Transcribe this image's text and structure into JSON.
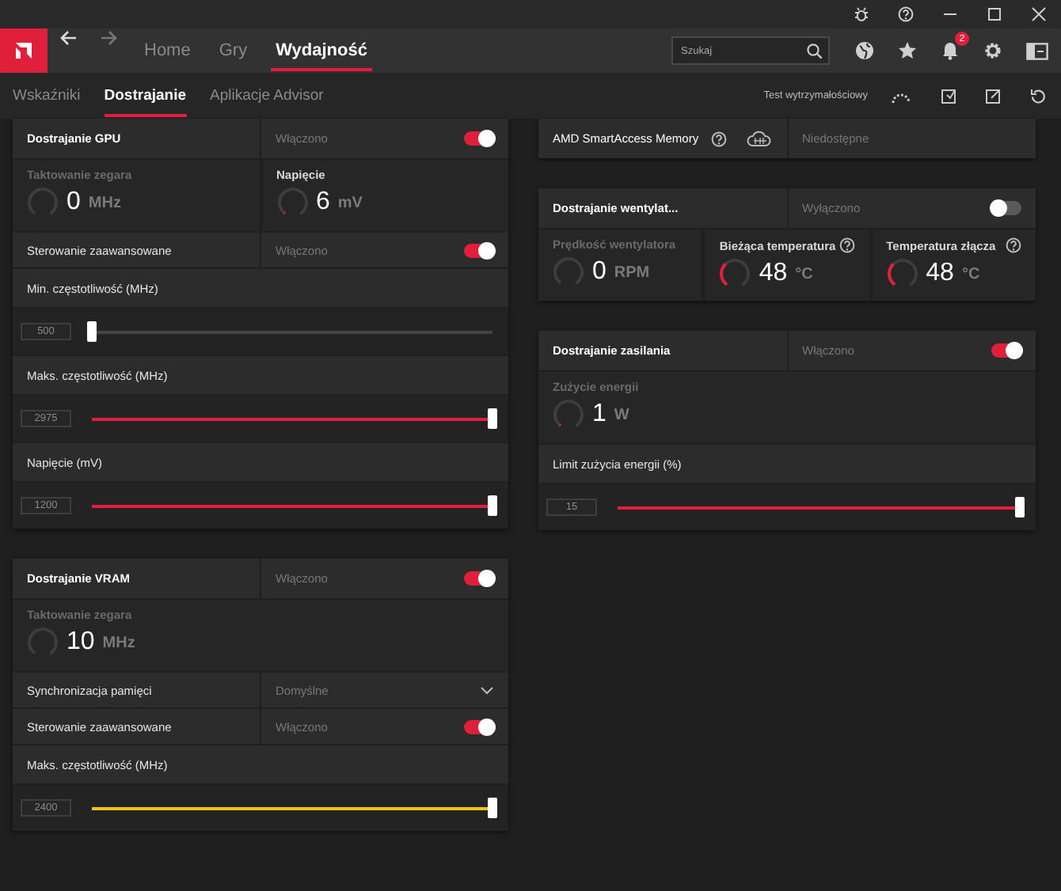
{
  "nav": {
    "tabs": [
      {
        "label": "Home",
        "selected": false
      },
      {
        "label": "Gry",
        "selected": false
      },
      {
        "label": "Wydajność",
        "selected": true
      }
    ],
    "search": {
      "placeholder": "Szukaj"
    },
    "notification_count": "2"
  },
  "subnav": {
    "tabs": [
      {
        "label": "Wskaźniki",
        "selected": false
      },
      {
        "label": "Dostrajanie",
        "selected": true
      },
      {
        "label": "Aplikacje Advisor",
        "selected": false
      }
    ],
    "stress_test": "Test wytrzymałościowy"
  },
  "columns": [
    {
      "cards": [
        {
          "kind": "toggle",
          "title": "Dostrajanie GPU",
          "status": "Włączono",
          "on": true,
          "rows": [
            {
              "kind": "metrics",
              "items": [
                {
                  "label": "Taktowanie zegara",
                  "value": "0",
                  "unit": "MHz",
                  "level": 0,
                  "active": false,
                  "help": false
                },
                {
                  "label": "Napięcie",
                  "value": "6",
                  "unit": "mV",
                  "level": 0.02,
                  "active": true,
                  "help": false
                }
              ]
            },
            {
              "kind": "toggle",
              "label": "Sterowanie zaawansowane",
              "status": "Włączono",
              "on": true
            },
            {
              "kind": "slider",
              "label": "Min. częstotliwość (MHz)",
              "value": "500",
              "level": 0
            },
            {
              "kind": "slider",
              "label": "Maks. częstotliwość (MHz)",
              "value": "2975",
              "level": 1,
              "color": "#e0203a"
            },
            {
              "kind": "slider",
              "label": "Napięcie (mV)",
              "value": "1200",
              "level": 1,
              "color": "#e0203a"
            }
          ]
        },
        {
          "kind": "toggle",
          "title": "Dostrajanie VRAM",
          "status": "Włączono",
          "on": true,
          "rows": [
            {
              "kind": "metrics",
              "items": [
                {
                  "label": "Taktowanie zegara",
                  "value": "10",
                  "unit": "MHz",
                  "level": 0,
                  "active": false,
                  "help": false
                }
              ]
            },
            {
              "kind": "dropdown",
              "label": "Synchronizacja pamięci",
              "value": "Domyślne"
            },
            {
              "kind": "toggle",
              "label": "Sterowanie zaawansowane",
              "status": "Włączono",
              "on": true
            },
            {
              "kind": "slider",
              "label": "Maks. częstotliwość (MHz)",
              "value": "2400",
              "level": 1,
              "color": "#f2c21b"
            }
          ]
        }
      ]
    },
    {
      "cards": [
        {
          "kind": "info",
          "title": "AMD SmartAccess Memory",
          "status": "Niedostępne"
        },
        {
          "kind": "toggle",
          "title": "Dostrajanie wentylat...",
          "status": "Wyłączono",
          "on": false,
          "rows": [
            {
              "kind": "metrics",
              "items": [
                {
                  "label": "Prędkość wentylatora",
                  "value": "0",
                  "unit": "RPM",
                  "level": 0,
                  "active": false,
                  "help": false
                },
                {
                  "label": "Bieżąca temperatura",
                  "value": "48",
                  "unit": "°C",
                  "level": 0.35,
                  "active": true,
                  "help": true
                },
                {
                  "label": "Temperatura złącza",
                  "value": "48",
                  "unit": "°C",
                  "level": 0.35,
                  "active": true,
                  "help": true
                }
              ]
            }
          ]
        },
        {
          "kind": "toggle",
          "title": "Dostrajanie zasilania",
          "status": "Włączono",
          "on": true,
          "rows": [
            {
              "kind": "metrics",
              "items": [
                {
                  "label": "Zużycie energii",
                  "value": "1",
                  "unit": "W",
                  "level": 0.02,
                  "active": false,
                  "help": false
                }
              ]
            },
            {
              "kind": "slider",
              "label": "Limit zużycia energii (%)",
              "value": "15",
              "level": 1,
              "color": "#e0203a"
            }
          ]
        }
      ]
    }
  ]
}
